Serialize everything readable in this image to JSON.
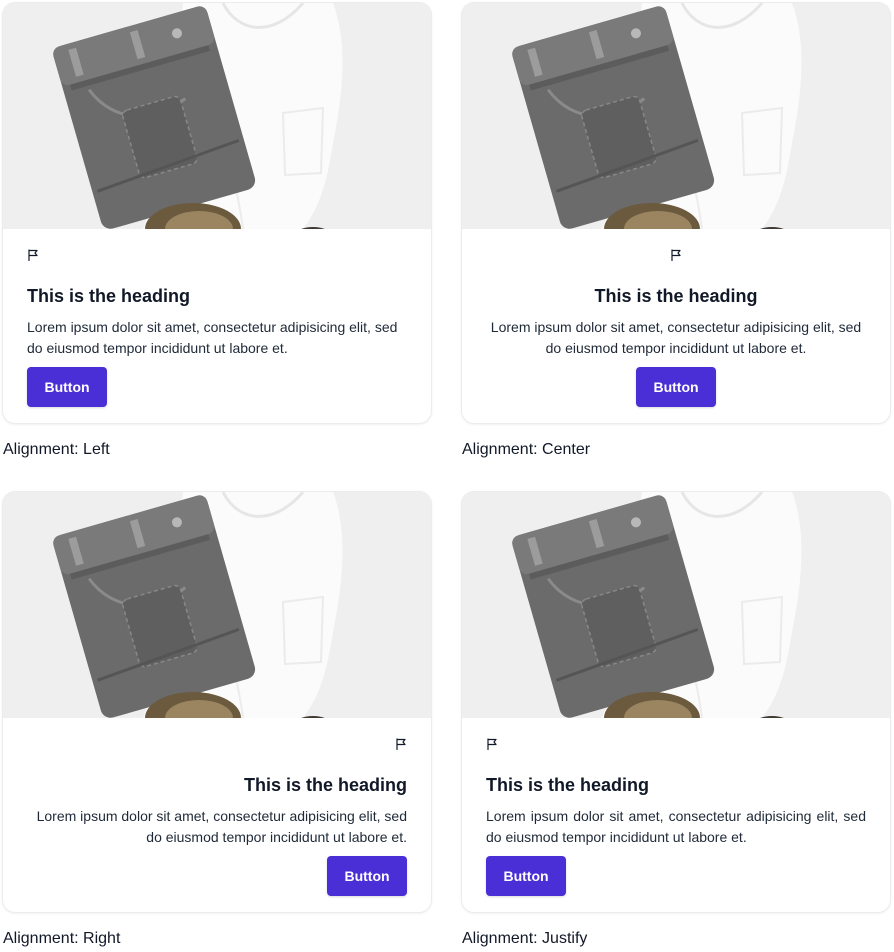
{
  "cards": [
    {
      "heading": "This is the heading",
      "text": "Lorem ipsum dolor sit amet, consectetur adipisicing elit, sed do eiusmod tempor incididunt ut labore et.",
      "button_label": "Button",
      "caption": "Alignment: Left",
      "icon": "flag-icon",
      "alignment": "left"
    },
    {
      "heading": "This is the heading",
      "text": "Lorem ipsum dolor sit amet, consectetur adipisicing elit, sed do eiusmod tempor incididunt ut labore et.",
      "button_label": "Button",
      "caption": "Alignment: Center",
      "icon": "flag-icon",
      "alignment": "center"
    },
    {
      "heading": "This is the heading",
      "text": "Lorem ipsum dolor sit amet, consectetur adipisicing elit, sed do eiusmod tempor incididunt ut labore et.",
      "button_label": "Button",
      "caption": "Alignment: Right",
      "icon": "flag-icon",
      "alignment": "right"
    },
    {
      "heading": "This is the heading",
      "text": "Lorem ipsum dolor sit amet, consectetur adipisicing elit, sed do eiusmod tempor incididunt ut labore et.",
      "button_label": "Button",
      "caption": "Alignment: Justify",
      "icon": "flag-icon",
      "alignment": "justify"
    }
  ],
  "colors": {
    "button_bg": "#4a2fd6",
    "button_text": "#ffffff",
    "heading": "#111827",
    "body_text": "#1f2937"
  }
}
